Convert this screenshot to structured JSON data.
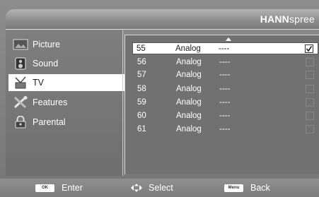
{
  "brand": {
    "bold": "HANN",
    "light": "spree"
  },
  "menu": [
    {
      "label": "Picture",
      "icon": "picture-icon"
    },
    {
      "label": "Sound",
      "icon": "speaker-icon"
    },
    {
      "label": "TV",
      "icon": "antenna-icon"
    },
    {
      "label": "Features",
      "icon": "tools-icon"
    },
    {
      "label": "Parental",
      "icon": "lock-icon"
    }
  ],
  "selected_menu": "TV",
  "channels": [
    {
      "number": "55",
      "type": "Analog",
      "name": "----",
      "checked": true
    },
    {
      "number": "56",
      "type": "Analog",
      "name": "----",
      "checked": false
    },
    {
      "number": "57",
      "type": "Analog",
      "name": "----",
      "checked": false
    },
    {
      "number": "58",
      "type": "Analog",
      "name": "----",
      "checked": false
    },
    {
      "number": "59",
      "type": "Analog",
      "name": "----",
      "checked": false
    },
    {
      "number": "60",
      "type": "Analog",
      "name": "----",
      "checked": false
    },
    {
      "number": "61",
      "type": "Analog",
      "name": "----",
      "checked": false
    }
  ],
  "footer": {
    "enter_key": "OK",
    "enter_label": "Enter",
    "select_label": "Select",
    "menu_key": "Menu",
    "back_label": "Back"
  }
}
